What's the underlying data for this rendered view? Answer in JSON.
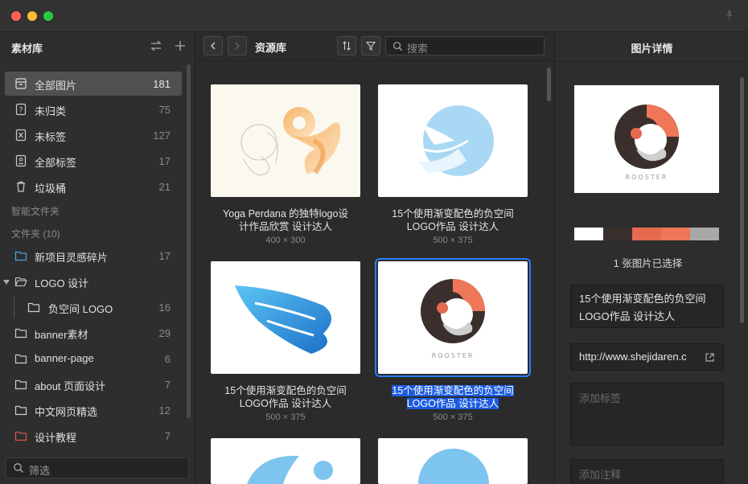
{
  "sidebar": {
    "title": "素材库",
    "items": [
      {
        "label": "全部图片",
        "count": "181",
        "icon": "all-images-icon"
      },
      {
        "label": "未归类",
        "count": "75",
        "icon": "uncategorized-icon"
      },
      {
        "label": "未标签",
        "count": "127",
        "icon": "untagged-icon"
      },
      {
        "label": "全部标签",
        "count": "17",
        "icon": "all-tags-icon"
      },
      {
        "label": "垃圾桶",
        "count": "21",
        "icon": "trash-icon"
      }
    ],
    "smart_folders_label": "智能文件夹",
    "folders_label": "文件夹 (10)",
    "folders": [
      {
        "label": "新项目灵感碎片",
        "count": "17"
      },
      {
        "label": "LOGO 设计",
        "count": ""
      },
      {
        "label": "负空间 LOGO",
        "count": "16"
      },
      {
        "label": "banner素材",
        "count": "29"
      },
      {
        "label": "banner-page",
        "count": "6"
      },
      {
        "label": "about 页面设计",
        "count": "7"
      },
      {
        "label": "中文网页精选",
        "count": "12"
      },
      {
        "label": "设计教程",
        "count": "7"
      }
    ],
    "filter_placeholder": "筛选"
  },
  "main": {
    "title": "资源库",
    "search_placeholder": "搜索",
    "cards": [
      {
        "name_line1": "Yoga Perdana 的独特logo设",
        "name_line2": "计作品欣赏  设计达人",
        "dims": "400 × 300"
      },
      {
        "name_line1": "15个使用渐变配色的负空间",
        "name_line2": "LOGO作品  设计达人",
        "dims": "500 × 375"
      },
      {
        "name_line1": "15个使用渐变配色的负空间",
        "name_line2": "LOGO作品  设计达人",
        "dims": "500 × 375"
      },
      {
        "name_line1": "15个使用渐变配色的负空间",
        "name_line2": "LOGO作品  设计达人",
        "dims": "500 × 375"
      }
    ],
    "rooster_text": "ROOSTER"
  },
  "detail": {
    "title": "图片详情",
    "palette": [
      "#ffffff",
      "#3a2f2c",
      "#e56a50",
      "#ee7659",
      "#a8a8a8"
    ],
    "selection_text": "1 张图片已选择",
    "name_line1": "15个使用渐变配色的负空间",
    "name_line2": "LOGO作品  设计达人",
    "url": "http://www.shejidaren.c",
    "tags_placeholder": "添加标签",
    "notes_placeholder": "添加注释"
  }
}
